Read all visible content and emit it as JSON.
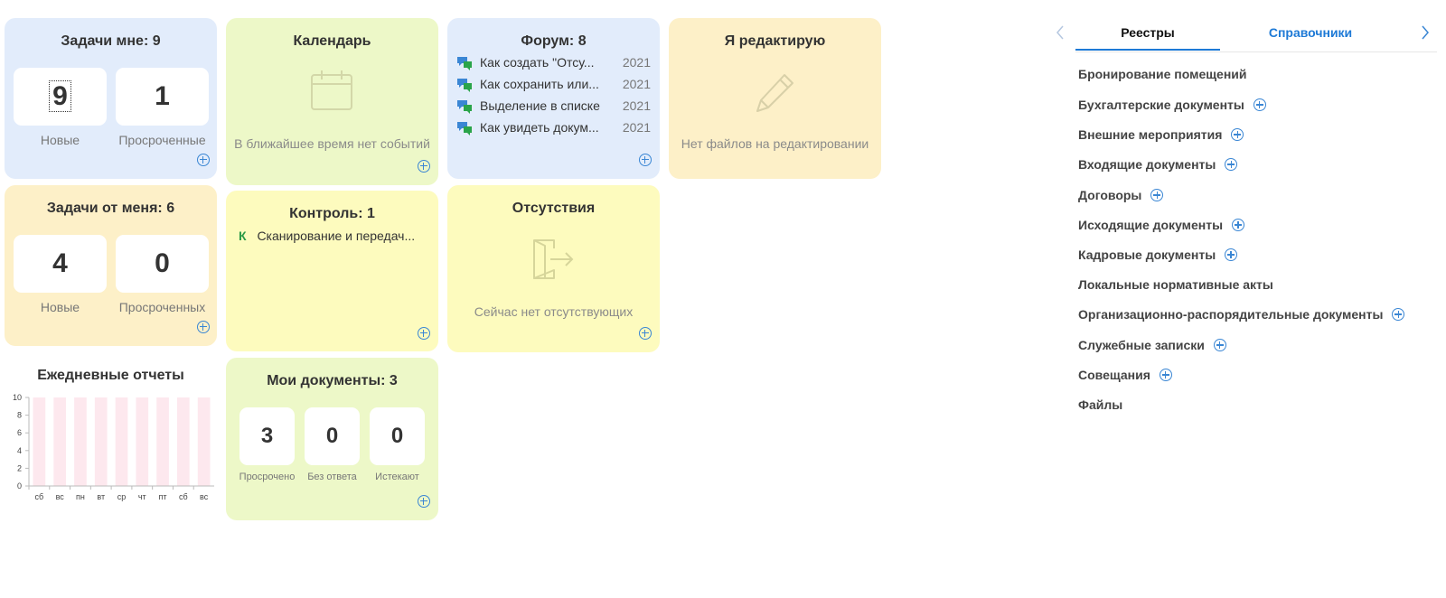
{
  "tasks_to_me": {
    "title": "Задачи мне: 9",
    "new_count": "9",
    "new_label": "Новые",
    "overdue_count": "1",
    "overdue_label": "Просроченные"
  },
  "calendar": {
    "title": "Календарь",
    "empty_text": "В ближайшее время нет событий"
  },
  "forum": {
    "title": "Форум: 8",
    "items": [
      {
        "title": "Как создать \"Отсу...",
        "year": "2021"
      },
      {
        "title": "Как сохранить или...",
        "year": "2021"
      },
      {
        "title": "Выделение в списке",
        "year": "2021"
      },
      {
        "title": "Как увидеть докум...",
        "year": "2021"
      }
    ]
  },
  "editing": {
    "title": "Я редактирую",
    "empty_text": "Нет файлов на редактировании"
  },
  "tasks_from_me": {
    "title": "Задачи от меня: 6",
    "new_count": "4",
    "new_label": "Новые",
    "overdue_count": "0",
    "overdue_label": "Просроченных"
  },
  "control": {
    "title": "Контроль: 1",
    "items": [
      {
        "marker": "К",
        "text": "Сканирование и передач..."
      }
    ]
  },
  "absences": {
    "title": "Отсутствия",
    "empty_text": "Сейчас нет отсутствующих"
  },
  "daily_reports": {
    "title": "Ежедневные отчеты"
  },
  "my_documents": {
    "title": "Мои документы: 3",
    "stats": [
      {
        "value": "3",
        "label": "Просрочено"
      },
      {
        "value": "0",
        "label": "Без ответа"
      },
      {
        "value": "0",
        "label": "Истекают"
      }
    ]
  },
  "registry_panel": {
    "tabs": [
      {
        "label": "Реестры",
        "active": true
      },
      {
        "label": "Справочники",
        "active": false
      }
    ],
    "items": [
      {
        "label": "Бронирование помещений",
        "addable": false
      },
      {
        "label": "Бухгалтерские документы",
        "addable": true
      },
      {
        "label": "Внешние мероприятия",
        "addable": true
      },
      {
        "label": "Входящие документы",
        "addable": true
      },
      {
        "label": "Договоры",
        "addable": true
      },
      {
        "label": "Исходящие документы",
        "addable": true
      },
      {
        "label": "Кадровые документы",
        "addable": true
      },
      {
        "label": "Локальные нормативные акты",
        "addable": false
      },
      {
        "label": "Организационно-распорядительные документы",
        "addable": true
      },
      {
        "label": "Служебные записки",
        "addable": true
      },
      {
        "label": "Совещания",
        "addable": true
      },
      {
        "label": "Файлы",
        "addable": false
      }
    ]
  },
  "colors": {
    "accent": "#1e7ad6",
    "card_blue": "#e2ecfb",
    "card_green": "#edf8c8",
    "card_peach": "#fdf0c8",
    "card_yellow": "#fdfbbe",
    "chart_bar": "#fde8ee"
  },
  "chart_data": {
    "type": "bar",
    "categories": [
      "сб",
      "вс",
      "пн",
      "вт",
      "ср",
      "чт",
      "пт",
      "сб",
      "вс"
    ],
    "values": [
      10,
      10,
      10,
      10,
      10,
      10,
      10,
      10,
      10
    ],
    "ylim": [
      0,
      10
    ],
    "yticks": [
      "0",
      "2",
      "4",
      "6",
      "8",
      "10"
    ],
    "title": "Ежедневные отчеты",
    "xlabel": "",
    "ylabel": "",
    "grid": false
  }
}
